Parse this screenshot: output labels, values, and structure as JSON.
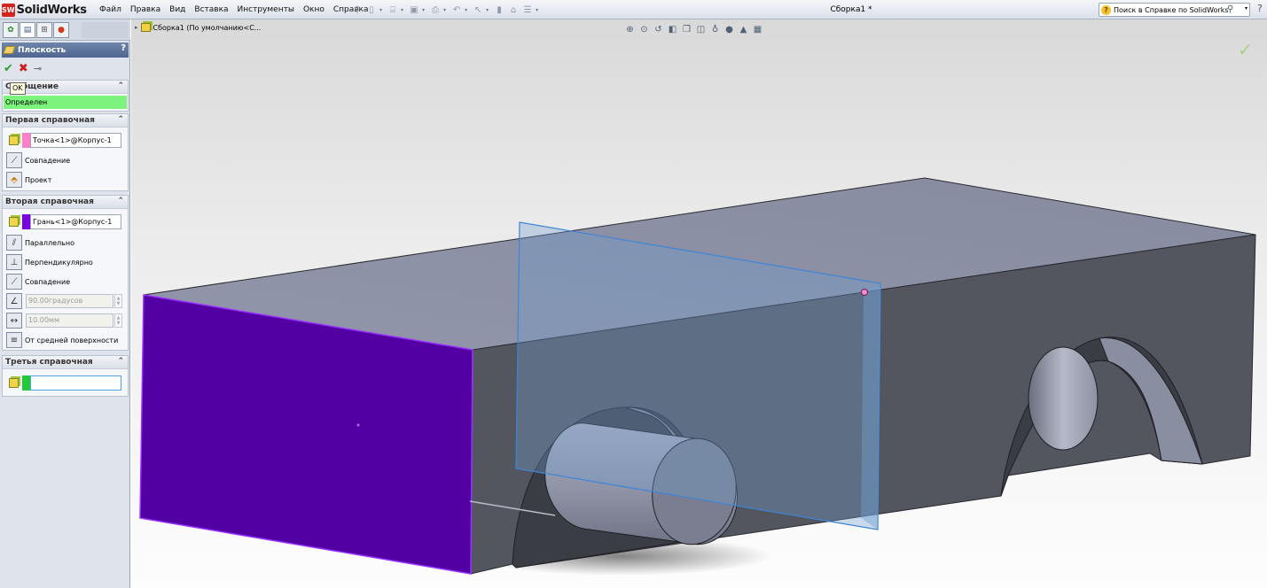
{
  "app": {
    "logo_mark": "SW",
    "logo_text": "SolidWorks",
    "menus": [
      "Файл",
      "Правка",
      "Вид",
      "Вставка",
      "Инструменты",
      "Окно",
      "Справка"
    ],
    "document_title": "Сборка1 *",
    "help_search_placeholder": "Поиск в Справке по SolidWorks",
    "help_icon": "?"
  },
  "property_manager": {
    "title": "Плоскость",
    "help_icon": "?",
    "ok_tooltip": "OK",
    "message": {
      "header": "Сообщение",
      "status": "Определен"
    },
    "first_reference": {
      "header": "Первая справочная",
      "selection": "Точка<1>@Корпус-1",
      "swatch_color": "#ff7fc8",
      "options": [
        "Совпадение",
        "Проект"
      ]
    },
    "second_reference": {
      "header": "Вторая справочная",
      "selection": "Грань<1>@Корпус-1",
      "swatch_color": "#7b00e0",
      "options": [
        "Параллельно",
        "Перпендикулярно",
        "Совпадение"
      ],
      "angle_value": "90.00градусов",
      "distance_value": "10.00мм",
      "mid_plane": "От средней поверхности"
    },
    "third_reference": {
      "header": "Третья справочная",
      "selection": "",
      "swatch_color": "#22c93a"
    }
  },
  "feature_tree": {
    "root": "Сборка1  (По умолчанию<С..."
  },
  "icons": {
    "tabs": [
      "feature-manager-icon",
      "property-manager-icon",
      "configuration-manager-icon",
      "appearance-icon"
    ],
    "view_toolbar": [
      "zoom-to-fit-icon",
      "zoom-area-icon",
      "previous-view-icon",
      "section-view-icon",
      "view-orientation-icon",
      "display-style-icon",
      "hide-show-icon",
      "edit-appearance-icon",
      "apply-scene-icon",
      "view-settings-icon"
    ]
  },
  "colors": {
    "selected_face": "#5200a3",
    "plane": "#6f9fcf",
    "body": "#555761",
    "body_top": "#9599ab",
    "message_ok": "#7cf37c"
  }
}
